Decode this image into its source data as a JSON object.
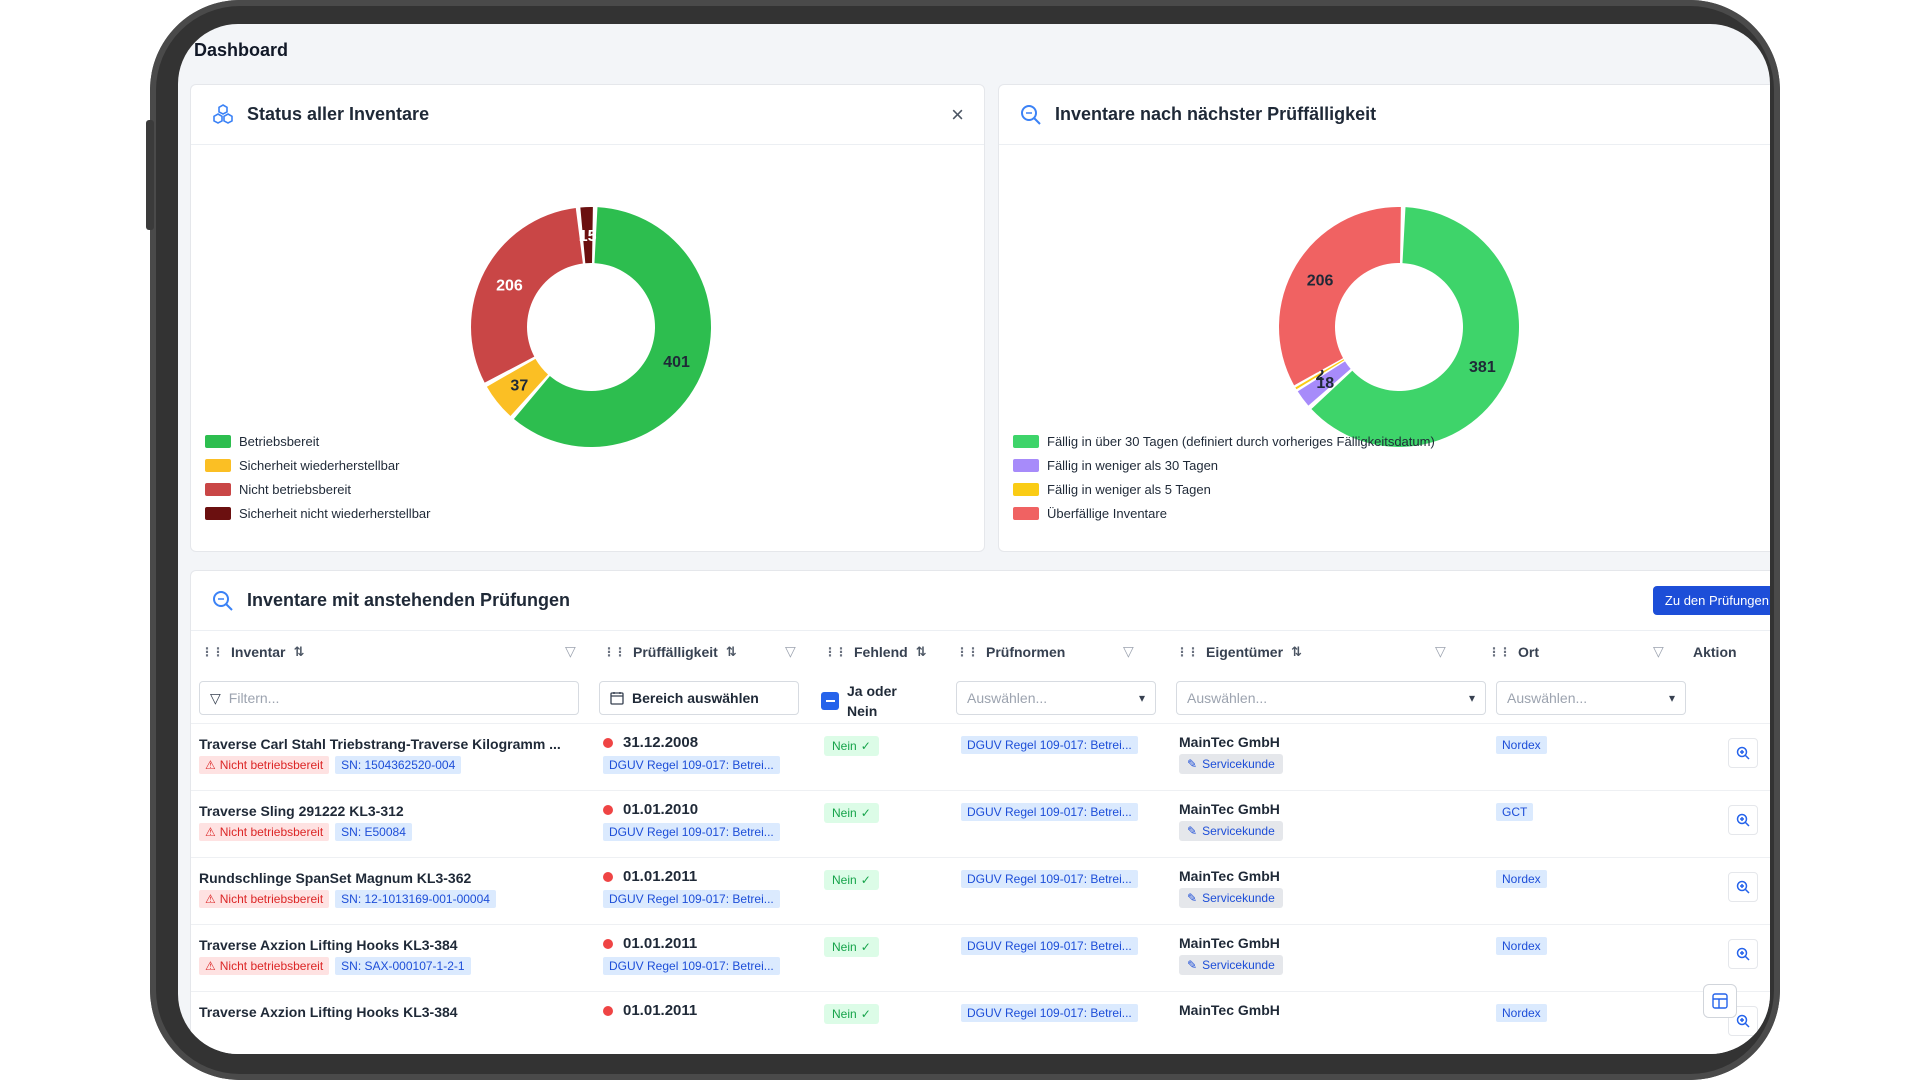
{
  "page": {
    "title": "Dashboard"
  },
  "status_card": {
    "title": "Status aller Inventare",
    "icon": "cubes-icon",
    "close_label": "×",
    "legend": [
      {
        "label": "Betriebsbereit",
        "color": "#2dbe4f"
      },
      {
        "label": "Sicherheit wiederherstellbar",
        "color": "#fbbf24"
      },
      {
        "label": "Nicht betriebsbereit",
        "color": "#c94646"
      },
      {
        "label": "Sicherheit nicht wiederherstellbar",
        "color": "#6b1010"
      }
    ]
  },
  "due_card": {
    "title": "Inventare nach nächster Prüffälligkeit",
    "icon": "search-icon",
    "legend": [
      {
        "label": "Fällig in über 30 Tagen (definiert durch vorheriges Fälligkeitsdatum)",
        "color": "#3ed46a"
      },
      {
        "label": "Fällig in weniger als 30 Tagen",
        "color": "#a78bfa"
      },
      {
        "label": "Fällig in weniger als 5 Tagen",
        "color": "#facc15"
      },
      {
        "label": "Überfällige Inventare",
        "color": "#f06262"
      }
    ]
  },
  "chart_data": [
    {
      "type": "pie",
      "categories": [
        "Betriebsbereit",
        "Sicherheit wiederherstellbar",
        "Nicht betriebsbereit",
        "Sicherheit nicht wiederherstellbar"
      ],
      "values": [
        401,
        37,
        206,
        15
      ],
      "colors": [
        "#2dbe4f",
        "#fbbf24",
        "#c94646",
        "#6b1010"
      ]
    },
    {
      "type": "pie",
      "categories": [
        "Fällig in über 30 Tagen (definiert durch vorheriges Fälligkeitsdatum)",
        "Fällig in weniger als 30 Tagen",
        "Fällig in weniger als 5 Tagen",
        "Überfällige Inventare"
      ],
      "values": [
        381,
        18,
        2,
        206
      ],
      "colors": [
        "#3ed46a",
        "#a78bfa",
        "#facc15",
        "#f06262"
      ]
    }
  ],
  "table_card": {
    "title": "Inventare mit anstehenden Prüfungen",
    "button_label": "Zu den Prüfungen",
    "columns": {
      "inventar": "Inventar",
      "pruef": "Prüffälligkeit",
      "fehlend": "Fehlend",
      "normen": "Prüfnormen",
      "eigentuemer": "Eigentümer",
      "ort": "Ort",
      "aktion": "Aktion"
    },
    "filters": {
      "inventar_placeholder": "Filtern...",
      "range_label": "Bereich auswählen",
      "tri_label_1": "Ja oder",
      "tri_label_2": "Nein",
      "normen_placeholder": "Auswählen...",
      "owner_placeholder": "Auswählen...",
      "ort_placeholder": "Auswählen..."
    },
    "rows": [
      {
        "name": "Traverse Carl Stahl Triebstrang-Traverse Kilogramm ...",
        "status": "Nicht betriebsbereit",
        "sn": "SN: 1504362520-004",
        "date": "31.12.2008",
        "norm_sub": "DGUV Regel 109-017: Betrei...",
        "missing": "Nein",
        "norm": "DGUV Regel 109-017: Betrei...",
        "owner": "MainTec GmbH",
        "owner_tag": "Servicekunde",
        "location": "Nordex"
      },
      {
        "name": "Traverse Sling 291222 KL3-312",
        "status": "Nicht betriebsbereit",
        "sn": "SN: E50084",
        "date": "01.01.2010",
        "norm_sub": "DGUV Regel 109-017: Betrei...",
        "missing": "Nein",
        "norm": "DGUV Regel 109-017: Betrei...",
        "owner": "MainTec GmbH",
        "owner_tag": "Servicekunde",
        "location": "GCT"
      },
      {
        "name": "Rundschlinge SpanSet Magnum KL3-362",
        "status": "Nicht betriebsbereit",
        "sn": "SN: 12-1013169-001-00004",
        "date": "01.01.2011",
        "norm_sub": "DGUV Regel 109-017: Betrei...",
        "missing": "Nein",
        "norm": "DGUV Regel 109-017: Betrei...",
        "owner": "MainTec GmbH",
        "owner_tag": "Servicekunde",
        "location": "Nordex"
      },
      {
        "name": "Traverse Axzion Lifting Hooks KL3-384",
        "status": "Nicht betriebsbereit",
        "sn": "SN: SAX-000107-1-2-1",
        "date": "01.01.2011",
        "norm_sub": "DGUV Regel 109-017: Betrei...",
        "missing": "Nein",
        "norm": "DGUV Regel 109-017: Betrei...",
        "owner": "MainTec GmbH",
        "owner_tag": "Servicekunde",
        "location": "Nordex"
      },
      {
        "name": "Traverse Axzion Lifting Hooks KL3-384",
        "status": "",
        "sn": "",
        "date": "01.01.2011",
        "norm_sub": "",
        "missing": "Nein",
        "norm": "DGUV Regel 109-017: Betrei...",
        "owner": "MainTec GmbH",
        "owner_tag": "",
        "location": "Nordex"
      }
    ]
  }
}
